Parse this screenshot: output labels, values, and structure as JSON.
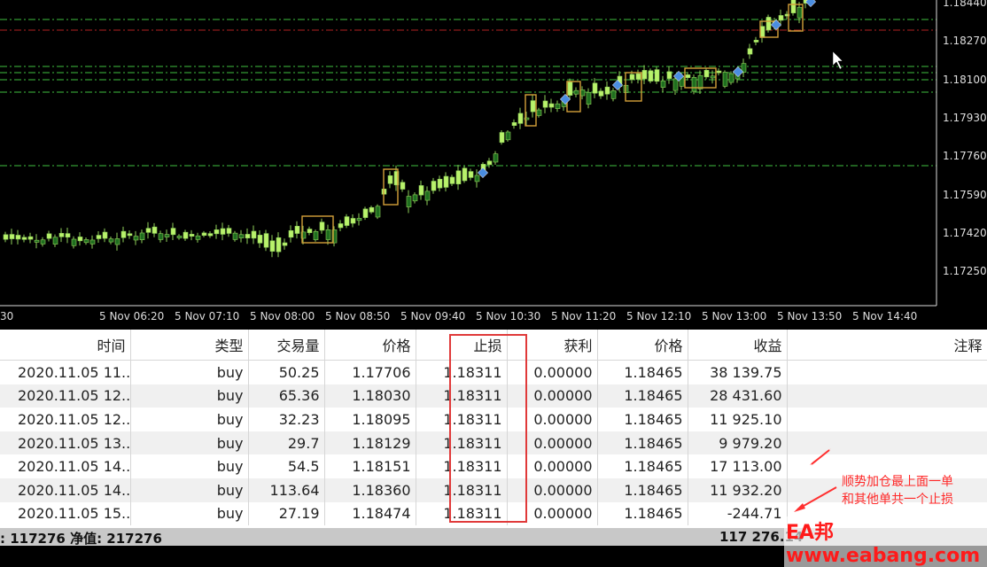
{
  "price_axis": [
    "1.18440",
    "1.18270",
    "1.18100",
    "1.17930",
    "1.17760",
    "1.17590",
    "1.17420",
    "1.17250"
  ],
  "time_axis": [
    "30",
    "5 Nov 06:20",
    "5 Nov 07:10",
    "5 Nov 08:00",
    "5 Nov 08:50",
    "5 Nov 09:40",
    "5 Nov 10:30",
    "5 Nov 11:20",
    "5 Nov 12:10",
    "5 Nov 13:00",
    "5 Nov 13:50",
    "5 Nov 14:40"
  ],
  "table": {
    "headers": [
      "时间",
      "类型",
      "交易量",
      "价格",
      "止损",
      "获利",
      "价格",
      "收益",
      "注释"
    ],
    "rows": [
      [
        "2020.11.05 11...",
        "buy",
        "50.25",
        "1.17706",
        "1.18311",
        "0.00000",
        "1.18465",
        "38 139.75"
      ],
      [
        "2020.11.05 12...",
        "buy",
        "65.36",
        "1.18030",
        "1.18311",
        "0.00000",
        "1.18465",
        "28 431.60"
      ],
      [
        "2020.11.05 12...",
        "buy",
        "32.23",
        "1.18095",
        "1.18311",
        "0.00000",
        "1.18465",
        "11 925.10"
      ],
      [
        "2020.11.05 13...",
        "buy",
        "29.7",
        "1.18129",
        "1.18311",
        "0.00000",
        "1.18465",
        "9 979.20"
      ],
      [
        "2020.11.05 14...",
        "buy",
        "54.5",
        "1.18151",
        "1.18311",
        "0.00000",
        "1.18465",
        "17 113.00"
      ],
      [
        "2020.11.05 14...",
        "buy",
        "113.64",
        "1.18360",
        "1.18311",
        "0.00000",
        "1.18465",
        "11 932.20"
      ],
      [
        "2020.11.05 15...",
        "buy",
        "27.19",
        "1.18474",
        "1.18311",
        "0.00000",
        "1.18465",
        "-244.71"
      ]
    ]
  },
  "summary": {
    "left": ": 117276  净值: 217276",
    "right": "117 276.14"
  },
  "annotation": {
    "line1": "顺势加仓最上面一单",
    "line2": "和其他单共一个止损"
  },
  "watermark": "EA邦www.eabang.com",
  "colors": {
    "up_candle": "#b9f26b",
    "down_candle": "#2e8b2e",
    "stop_line": "#b22222",
    "level_line": "#3fbf3f"
  }
}
